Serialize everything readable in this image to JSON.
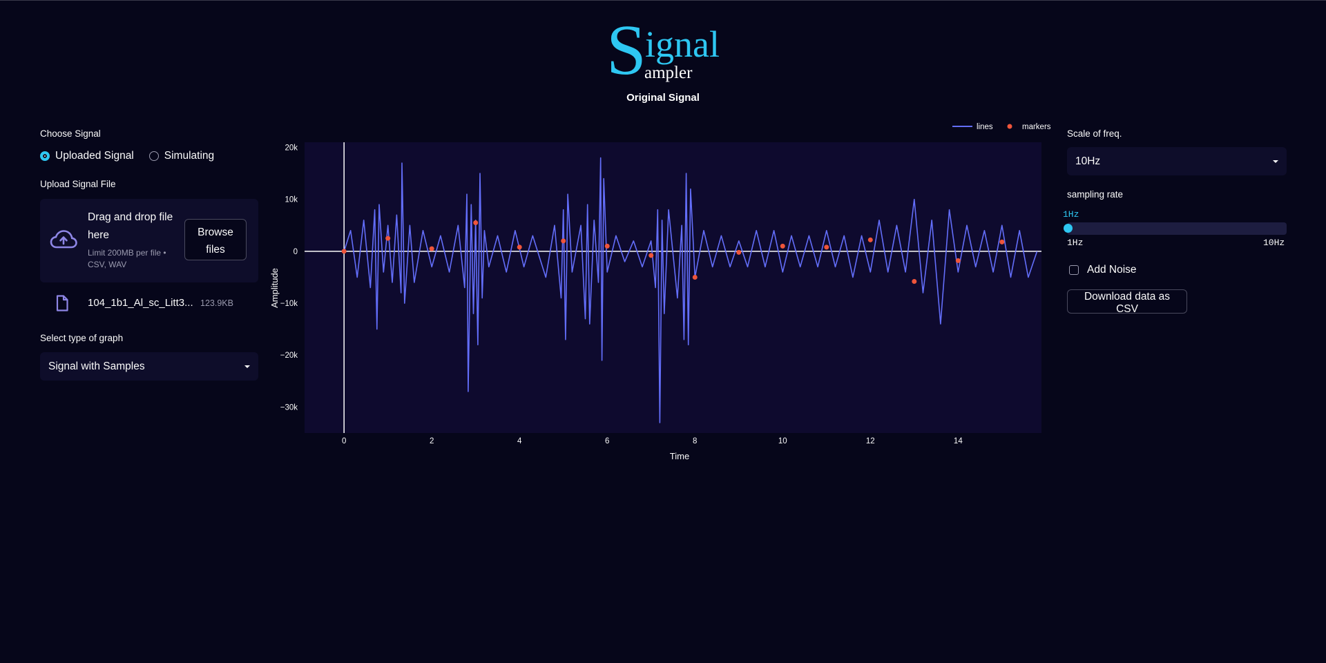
{
  "logo": {
    "big_letter": "S",
    "upper": "ignal",
    "lower": "ampler"
  },
  "chart_title": "Original Signal",
  "left": {
    "choose_label": "Choose Signal",
    "radio_options": [
      "Uploaded Signal",
      "Simulating"
    ],
    "radio_selected": "Uploaded Signal",
    "upload_label": "Upload Signal File",
    "dropzone_title": "Drag and drop file here",
    "dropzone_limit": "Limit 200MB per file • CSV, WAV",
    "browse_label": "Browse files",
    "file_name": "104_1b1_Al_sc_Litt3...",
    "file_size": "123.9KB",
    "graph_type_label": "Select type of graph",
    "graph_type_value": "Signal with Samples"
  },
  "right": {
    "scale_label": "Scale of freq.",
    "scale_value": "10Hz",
    "sampling_label": "sampling rate",
    "sampling_value": "1Hz",
    "sampling_level": 0,
    "sampling_min": "1Hz",
    "sampling_max": "10Hz",
    "noise_label": "Add Noise",
    "noise_checked": false,
    "download_label": "Download data as CSV"
  },
  "colors": {
    "accent": "#2ec7f2",
    "line": "#636efa",
    "marker": "#ef553b",
    "plot_bg": "#0e0a2e",
    "page_bg": "#06061a"
  },
  "icons": {
    "upload": "cloud-upload-icon",
    "file": "file-icon"
  },
  "chart_data": {
    "type": "line",
    "xlabel": "Time",
    "ylabel": "Amplitude",
    "xlim": [
      -0.9,
      15.9
    ],
    "ylim": [
      -35000,
      21000
    ],
    "x_ticks": [
      0,
      2,
      4,
      6,
      8,
      10,
      12,
      14
    ],
    "x_tick_labels": [
      "0",
      "2",
      "4",
      "6",
      "8",
      "10",
      "12",
      "14"
    ],
    "y_ticks": [
      20000,
      10000,
      0,
      -10000,
      -20000,
      -30000
    ],
    "y_tick_labels": [
      "20k",
      "10k",
      "0",
      "−10k",
      "−20k",
      "−30k"
    ],
    "legend": {
      "placement": "top-right",
      "entries": [
        "lines",
        "markers"
      ]
    },
    "series": [
      {
        "name": "lines",
        "mode": "lines",
        "x": [
          0,
          0.15,
          0.3,
          0.45,
          0.6,
          0.7,
          0.75,
          0.8,
          0.9,
          1.0,
          1.1,
          1.2,
          1.3,
          1.32,
          1.38,
          1.5,
          1.6,
          1.8,
          2.0,
          2.2,
          2.4,
          2.6,
          2.75,
          2.8,
          2.83,
          2.9,
          2.95,
          3.0,
          3.05,
          3.1,
          3.15,
          3.2,
          3.3,
          3.5,
          3.7,
          3.9,
          4.1,
          4.3,
          4.6,
          4.8,
          4.95,
          5.0,
          5.05,
          5.1,
          5.2,
          5.4,
          5.5,
          5.55,
          5.6,
          5.7,
          5.8,
          5.85,
          5.88,
          5.92,
          6.0,
          6.2,
          6.4,
          6.6,
          6.8,
          7.0,
          7.1,
          7.15,
          7.2,
          7.25,
          7.3,
          7.4,
          7.6,
          7.7,
          7.75,
          7.8,
          7.85,
          7.9,
          8.0,
          8.2,
          8.4,
          8.6,
          8.8,
          9.0,
          9.2,
          9.4,
          9.6,
          9.8,
          10.0,
          10.2,
          10.4,
          10.6,
          10.8,
          11.0,
          11.2,
          11.4,
          11.6,
          11.8,
          12.0,
          12.2,
          12.4,
          12.6,
          12.8,
          13.0,
          13.2,
          13.4,
          13.6,
          13.8,
          14.0,
          14.2,
          14.4,
          14.6,
          14.8,
          15.0,
          15.2,
          15.4,
          15.6,
          15.8
        ],
        "y": [
          0,
          4000,
          -5000,
          6000,
          -7000,
          8000,
          -15000,
          9000,
          -4000,
          5000,
          -6000,
          7000,
          -8000,
          17000,
          -10000,
          5000,
          -6000,
          4000,
          -3000,
          3000,
          -4000,
          5000,
          -7000,
          11000,
          -27000,
          9000,
          -12000,
          6000,
          -18000,
          15000,
          -9000,
          4000,
          -3000,
          3000,
          -4000,
          4000,
          -3000,
          3000,
          -5000,
          5000,
          -9000,
          8000,
          -17000,
          11000,
          -4000,
          5000,
          -13000,
          9000,
          -14000,
          6000,
          -6000,
          18000,
          -21000,
          14000,
          -4000,
          3000,
          -2000,
          2000,
          -3000,
          2000,
          -7000,
          8000,
          -33000,
          6000,
          -12000,
          8000,
          -9000,
          5000,
          -17000,
          15000,
          -18000,
          12000,
          -5000,
          4000,
          -3000,
          3000,
          -3000,
          2000,
          -3000,
          4000,
          -3000,
          4000,
          -4000,
          3000,
          -3000,
          3000,
          -3000,
          4000,
          -3000,
          3000,
          -5000,
          3000,
          -4000,
          6000,
          -4000,
          5000,
          -4000,
          10000,
          -8000,
          6000,
          -14000,
          8000,
          -4000,
          5000,
          -3000,
          4000,
          -4000,
          5000,
          -5000,
          4000,
          -5000,
          0
        ]
      },
      {
        "name": "markers",
        "mode": "markers",
        "x": [
          0,
          1,
          2,
          3,
          4,
          5,
          6,
          7,
          8,
          9,
          10,
          11,
          12,
          13,
          14,
          15
        ],
        "y": [
          0,
          2500,
          500,
          5500,
          800,
          2000,
          1000,
          -800,
          -5000,
          -200,
          1000,
          800,
          2200,
          -5800,
          -1800,
          1800
        ]
      }
    ]
  }
}
